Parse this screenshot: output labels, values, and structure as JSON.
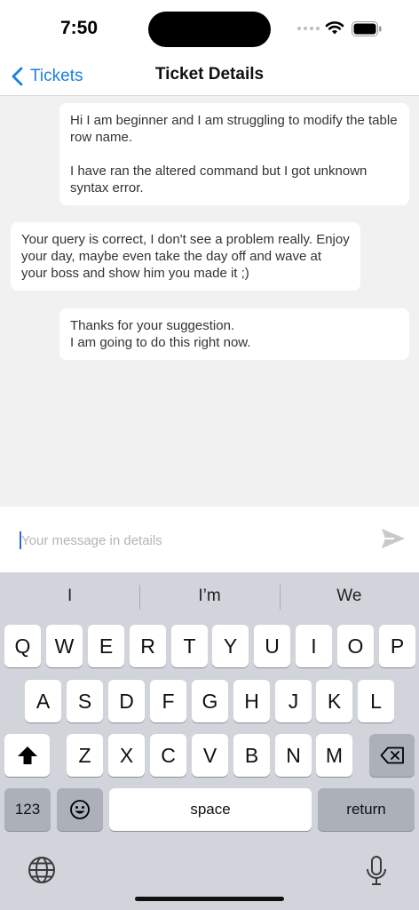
{
  "status_bar": {
    "time": "7:50"
  },
  "nav": {
    "back_label": "Tickets",
    "title": "Ticket Details",
    "accent": "#1a7fe0"
  },
  "messages": [
    {
      "from": "user",
      "text": "Hi I am beginner and I am struggling to modify the table row name.\n\nI have ran the altered command but I got unknown syntax error."
    },
    {
      "from": "support",
      "text": "Your query is correct, I don't see a problem really. Enjoy your day, maybe even take the day off and wave at your boss and show him you made it ;)"
    },
    {
      "from": "user",
      "text": "Thanks for your suggestion.\nI am going to do this right now."
    }
  ],
  "composer": {
    "placeholder": "Your message in details",
    "value": ""
  },
  "keyboard": {
    "predictions": [
      "I",
      "I’m",
      "We"
    ],
    "row1": [
      "Q",
      "W",
      "E",
      "R",
      "T",
      "Y",
      "U",
      "I",
      "O",
      "P"
    ],
    "row2": [
      "A",
      "S",
      "D",
      "F",
      "G",
      "H",
      "J",
      "K",
      "L"
    ],
    "row3": [
      "Z",
      "X",
      "C",
      "V",
      "B",
      "N",
      "M"
    ],
    "numbers_label": "123",
    "space_label": "space",
    "return_label": "return"
  }
}
